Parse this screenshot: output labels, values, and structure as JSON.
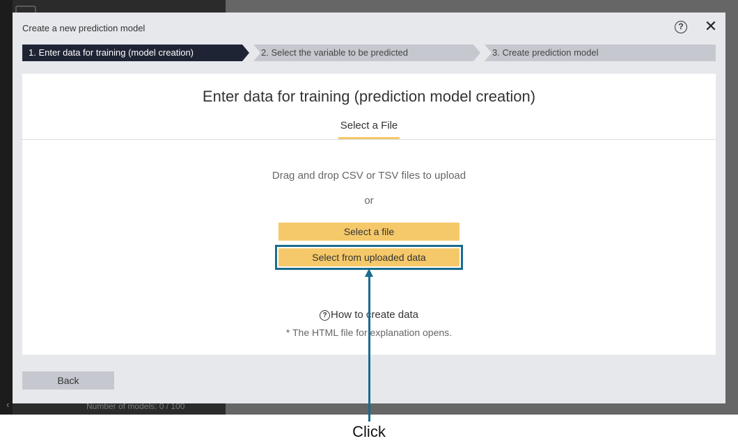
{
  "background": {
    "models_count": "Number of models: 0 / 100"
  },
  "modal": {
    "title": "Create a new prediction model",
    "help_icon": "?",
    "close_icon": "✕"
  },
  "steps": [
    {
      "label": "1. Enter data for training (model creation)",
      "active": true
    },
    {
      "label": "2. Select the variable to be predicted",
      "active": false
    },
    {
      "label": "3. Create prediction model",
      "active": false
    }
  ],
  "panel": {
    "title": "Enter data for training (prediction model creation)",
    "tab_label": "Select a File",
    "drop_text": "Drag and drop CSV or TSV files to upload",
    "or_text": "or",
    "select_file_button": "Select a file",
    "select_uploaded_button": "Select from uploaded data",
    "howto_icon": "?",
    "howto_text": "How to create data",
    "note": "* The HTML file for explanation opens."
  },
  "footer": {
    "back_button": "Back"
  },
  "annotation": {
    "click_label": "Click"
  },
  "colors": {
    "accent_yellow": "#f5c96a",
    "step_active": "#1f2435",
    "highlight": "#1b6b8c"
  }
}
